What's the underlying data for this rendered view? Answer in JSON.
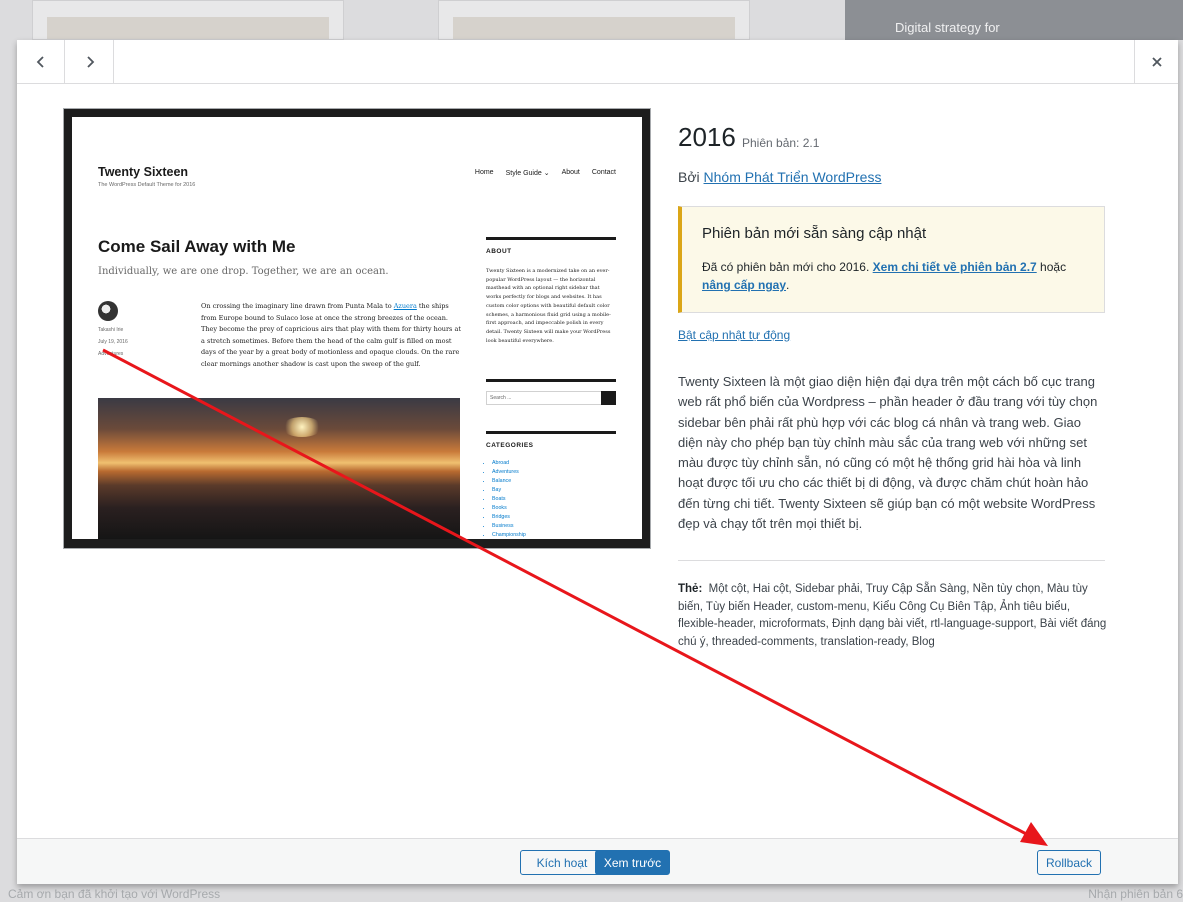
{
  "background": {
    "dark_card_text": "Digital strategy for",
    "footer_left": "Cảm ơn bạn đã khởi tạo với WordPress",
    "footer_right": "Nhận phiên bản 6"
  },
  "header": {
    "prev_icon": "chevron-left-icon",
    "next_icon": "chevron-right-icon",
    "close_icon": "close-icon"
  },
  "screenshot": {
    "site_title": "Twenty Sixteen",
    "site_desc": "The WordPress Default Theme for 2016",
    "nav": [
      "Home",
      "Style Guide ⌄",
      "About",
      "Contact"
    ],
    "post_title": "Come Sail Away with Me",
    "post_subtitle": "Individually, we are one drop. Together, we are an ocean.",
    "author": "Takashi Irie",
    "date": "July 19, 2016",
    "category": "Adventures",
    "body_before": "On crossing the imaginary line drawn from Punta Mala to ",
    "body_link": "Azuera",
    "body_after": " the ships from Europe bound to Sulaco lose at once the strong breezes of the ocean. They become the prey of capricious airs that play with them for thirty hours at a stretch sometimes. Before them the head of the calm gulf is filled on most days of the year by a great body of motionless and opaque clouds. On the rare clear mornings another shadow is cast upon the sweep of the gulf.",
    "about_title": "ABOUT",
    "about_text": "Twenty Sixteen is a modernized take on an ever-popular WordPress layout — the horizontal masthead with an optional right sidebar that works perfectly for blogs and websites. It has custom color options with beautiful default color schemes, a harmonious fluid grid using a mobile-first approach, and impeccable polish in every detail. Twenty Sixteen will make your WordPress look beautiful everywhere.",
    "search_placeholder": "Search ...",
    "categories_title": "CATEGORIES",
    "categories": [
      "Abroad",
      "Adventures",
      "Balance",
      "Bay",
      "Boats",
      "Books",
      "Bridges",
      "Business",
      "Championship"
    ]
  },
  "theme": {
    "name": "2016",
    "version": "Phiên bản: 2.1",
    "author_prefix": "Bởi ",
    "author": "Nhóm Phát Triển WordPress",
    "notice_title": "Phiên bản mới sẵn sàng cập nhật",
    "notice_text_1": "Đã có phiên bản mới cho 2016. ",
    "notice_link_1": "Xem chi tiết về phiên bản 2.7",
    "notice_text_2": " hoặc ",
    "notice_link_2": "nâng cấp ngay",
    "notice_text_3": ".",
    "auto_update": "Bật cập nhật tự động",
    "description": "Twenty Sixteen là một giao diện hiện đại dựa trên một cách bố cục trang web rất phổ biến của Wordpress – phần header ở đầu trang với tùy chọn sidebar bên phải rất phù hợp với các blog cá nhân và trang web. Giao diện này cho phép bạn tùy chỉnh màu sắc của trang web với những set màu được tùy chỉnh sẵn, nó cũng có một hệ thống grid hài hòa và linh hoạt được tối ưu cho các thiết bị di động, và được chăm chút hoàn hảo đến từng chi tiết. Twenty Sixteen sẽ giúp bạn có một website WordPress đẹp và chạy tốt trên mọi thiết bị.",
    "tags_label": "Thẻ:",
    "tags": "Một cột, Hai cột, Sidebar phải, Truy Cập Sẵn Sàng, Nền tùy chọn, Màu tùy biến, Tùy biến Header, custom-menu, Kiểu Công Cụ Biên Tập, Ảnh tiêu biểu, flexible-header, microformats, Định dạng bài viết, rtl-language-support, Bài viết đáng chú ý, threaded-comments, translation-ready, Blog"
  },
  "footer": {
    "activate": "Kích hoạt",
    "preview": "Xem trước",
    "rollback": "Rollback"
  },
  "colors": {
    "accent": "#2271b1",
    "notice_border": "#dba617",
    "annotation": "#e8161b"
  }
}
